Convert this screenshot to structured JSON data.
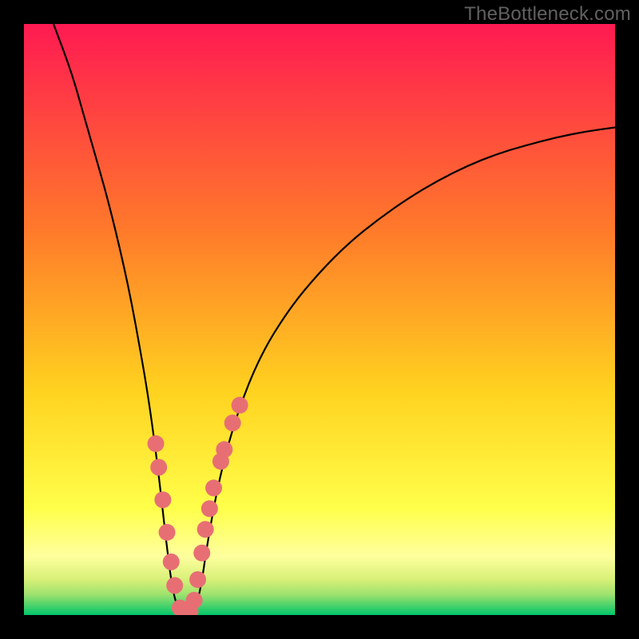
{
  "watermark": {
    "text": "TheBottleneck.com"
  },
  "colors": {
    "background": "#000000",
    "curve": "#000000",
    "marker_fill": "#e76f74",
    "marker_stroke": "#d55a5f",
    "gradient_top": "#ff1a52",
    "gradient_mid1": "#ff7a2a",
    "gradient_mid2": "#ffd21f",
    "gradient_low": "#ffff4a",
    "gradient_band": "#ffff9e",
    "gradient_green_top": "#9fe26e",
    "gradient_green_bot": "#00c66a"
  },
  "chart_data": {
    "type": "line",
    "title": "",
    "xlabel": "",
    "ylabel": "",
    "xlim": [
      0,
      100
    ],
    "ylim": [
      0,
      100
    ],
    "grid": false,
    "legend": false,
    "series": [
      {
        "name": "bottleneck-curve",
        "x": [
          5,
          8,
          10,
          12,
          14,
          16,
          18,
          20,
          21,
          22,
          23,
          24,
          25,
          26,
          27,
          28,
          29,
          30,
          31,
          33,
          36,
          40,
          45,
          50,
          55,
          60,
          65,
          70,
          75,
          80,
          85,
          90,
          95,
          100
        ],
        "y": [
          100,
          92,
          85,
          78,
          71,
          63,
          54,
          43,
          37,
          30,
          22,
          13,
          5,
          1,
          0,
          0,
          1,
          5,
          12,
          23,
          34,
          44,
          52,
          58,
          63,
          67,
          70.5,
          73.5,
          76,
          78,
          79.5,
          80.8,
          81.8,
          82.5
        ]
      }
    ],
    "markers": {
      "name": "highlighted-points",
      "x": [
        22.3,
        22.8,
        23.5,
        24.2,
        24.9,
        25.5,
        26.4,
        27.3,
        28.1,
        28.8,
        29.4,
        30.1,
        30.7,
        31.4,
        32.1,
        33.3,
        33.9,
        35.3,
        36.5
      ],
      "y": [
        29,
        25,
        19.5,
        14,
        9,
        5,
        1.2,
        0.4,
        0.6,
        2.5,
        6,
        10.5,
        14.5,
        18,
        21.5,
        26,
        28,
        32.5,
        35.5
      ]
    }
  }
}
